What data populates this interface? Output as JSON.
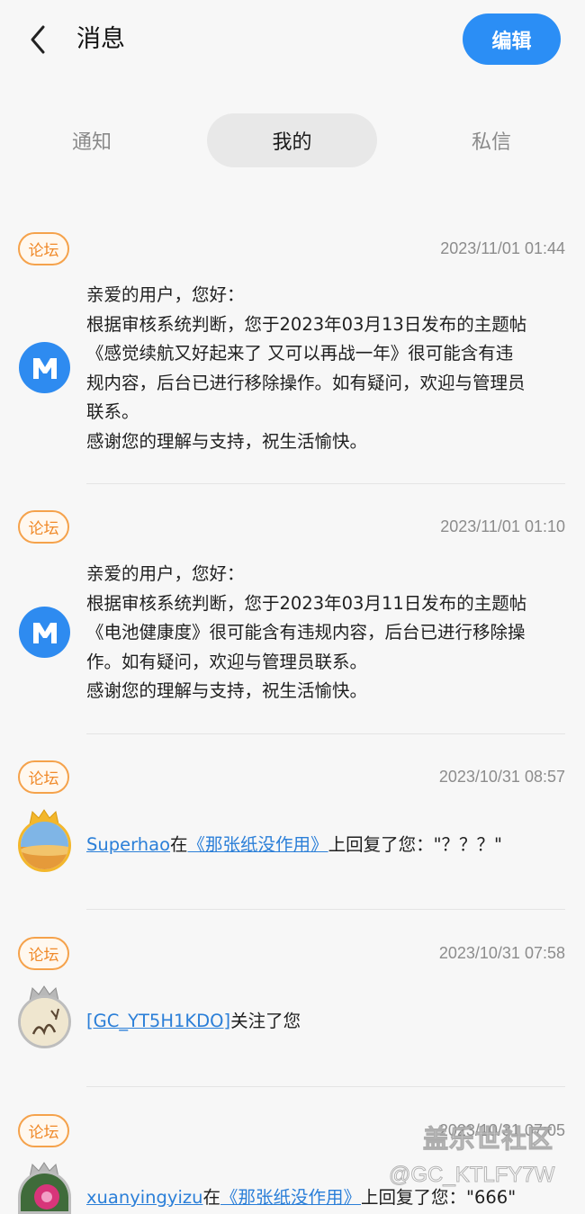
{
  "header": {
    "title": "消息",
    "edit_label": "编辑"
  },
  "tabs": [
    {
      "label": "通知",
      "active": false
    },
    {
      "label": "我的",
      "active": true
    },
    {
      "label": "私信",
      "active": false
    }
  ],
  "colors": {
    "accent": "#2b8ef5",
    "tag_orange": "#f08a2a",
    "link": "#2b7fd8"
  },
  "messages": [
    {
      "tag": "论坛",
      "time": "2023/11/01 01:44",
      "avatar_icon": "m-logo-icon",
      "lines": [
        "亲爱的用户，您好：",
        "根据审核系统判断，您于2023年03月13日发布的主题帖",
        "《感觉续航又好起来了 又可以再战一年》很可能含有违",
        "规内容，后台已进行移除操作。如有疑问，欢迎与管理员",
        "联系。",
        "感谢您的理解与支持，祝生活愉快。"
      ]
    },
    {
      "tag": "论坛",
      "time": "2023/11/01 01:10",
      "avatar_icon": "m-logo-icon",
      "lines": [
        "亲爱的用户，您好：",
        "根据审核系统判断，您于2023年03月11日发布的主题帖",
        "《电池健康度》很可能含有违规内容，后台已进行移除操",
        "作。如有疑问，欢迎与管理员联系。",
        "感谢您的理解与支持，祝生活愉快。"
      ]
    },
    {
      "tag": "论坛",
      "time": "2023/10/31 08:57",
      "user": "Superhao",
      "mid1": "在",
      "thread": "《那张纸没作用》",
      "action": "上回复了您：\"？？？\""
    },
    {
      "tag": "论坛",
      "time": "2023/10/31 07:58",
      "user": "[GC_YT5H1KDO]",
      "action": "关注了您"
    },
    {
      "tag": "论坛",
      "time": "2023/10/31 07:05",
      "user": "xuanyingyizu",
      "mid1": "在",
      "thread": "《那张纸没作用》",
      "action": "上回复了您：\"666\""
    }
  ],
  "watermark": {
    "line1": "盖乐世社区",
    "line2": "@GC_KTLFY7W"
  }
}
